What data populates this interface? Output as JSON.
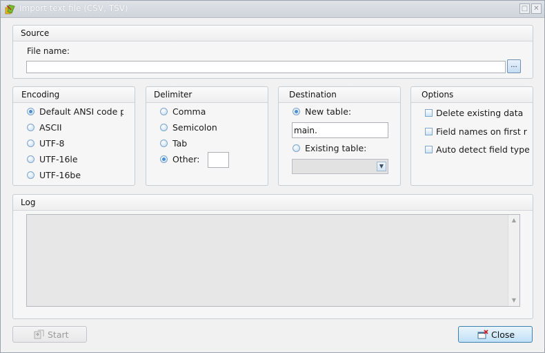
{
  "window": {
    "title": "Import text file (CSV, TSV)",
    "maximize_glyph": "□",
    "close_glyph": "✕"
  },
  "source": {
    "group_title": "Source",
    "file_name_label": "File name:",
    "file_name_value": "",
    "browse_label": "..."
  },
  "encoding": {
    "group_title": "Encoding",
    "options": [
      {
        "label": "Default ANSI code pa",
        "checked": true
      },
      {
        "label": "ASCII",
        "checked": false
      },
      {
        "label": "UTF-8",
        "checked": false
      },
      {
        "label": "UTF-16le",
        "checked": false
      },
      {
        "label": "UTF-16be",
        "checked": false
      }
    ]
  },
  "delimiter": {
    "group_title": "Delimiter",
    "options": [
      {
        "label": "Comma",
        "checked": false
      },
      {
        "label": "Semicolon",
        "checked": false
      },
      {
        "label": "Tab",
        "checked": false
      },
      {
        "label": "Other:",
        "checked": true
      }
    ],
    "other_value": ""
  },
  "destination": {
    "group_title": "Destination",
    "new_table_label": "New table:",
    "new_table_checked": true,
    "new_table_value": "main.",
    "existing_table_label": "Existing table:",
    "existing_table_checked": false,
    "existing_table_value": ""
  },
  "options": {
    "group_title": "Options",
    "items": [
      {
        "label": "Delete existing data",
        "checked": false
      },
      {
        "label": "Field names on first r",
        "checked": false
      },
      {
        "label": "Auto detect field type",
        "checked": false
      }
    ]
  },
  "log": {
    "group_title": "Log",
    "content": ""
  },
  "buttons": {
    "start_label": "Start",
    "close_label": "Close"
  },
  "colors": {
    "accent": "#4c8ed0",
    "window_bg": "#f1f1f1",
    "primary_button": "#bfe0f7"
  },
  "icons": {
    "app": "app-icon",
    "browse": "ellipsis-icon",
    "start": "start-icon",
    "close": "close-window-icon"
  }
}
